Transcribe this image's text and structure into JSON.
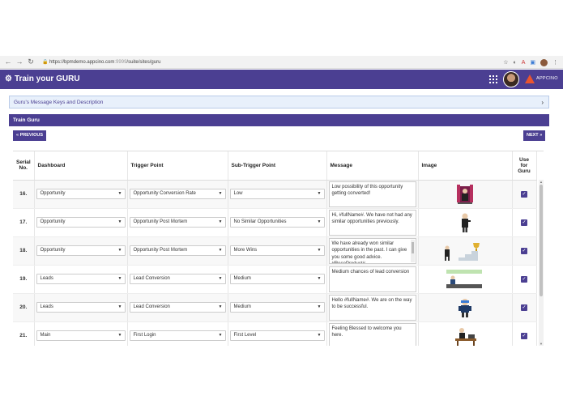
{
  "browser": {
    "url_host": "https://bpmdemo.appcino.com",
    "url_port": ":9999",
    "url_path": "/suite/sites/guru"
  },
  "app": {
    "title": "Train your GURU",
    "logo_text": "APPCINO",
    "accent": "#4b3f92",
    "logo_color": "#e9552f"
  },
  "accordion": {
    "label": "Guru's Message Keys and Description",
    "chevron": "›"
  },
  "panel": {
    "title": "Train Guru",
    "prev_label": "« PREVIOUS",
    "next_label": "NEXT »"
  },
  "table": {
    "headers": {
      "serial": "Serial No.",
      "dashboard": "Dashboard",
      "trigger": "Trigger Point",
      "subtrigger": "Sub-Trigger Point",
      "message": "Message",
      "image": "Image",
      "use": "Use for Guru"
    },
    "rows": [
      {
        "serial": "16.",
        "dashboard": "Opportunity",
        "trigger": "Opportunity Conversion Rate",
        "subtrigger": "Low",
        "message": "Low possibility of this opportunity getting converted!",
        "image_icon": "throne-character-icon",
        "checked": true
      },
      {
        "serial": "17.",
        "dashboard": "Opportunity",
        "trigger": "Opportunity Post Mortem",
        "subtrigger": "No Similar Opportunities",
        "message": "Hi, #fullName#. We have not had any similar opportunities previously.",
        "image_icon": "standing-character-icon",
        "checked": true
      },
      {
        "serial": "18.",
        "dashboard": "Opportunity",
        "trigger": "Opportunity Post Mortem",
        "subtrigger": "More Wins",
        "message": "We have already won similar opportunities in the past. I can give you some good advice. #RecoProduct#",
        "image_icon": "stairs-trophy-icon",
        "checked": true
      },
      {
        "serial": "19.",
        "dashboard": "Leads",
        "trigger": "Lead Conversion",
        "subtrigger": "Medium",
        "message": "Medium chances of lead conversion",
        "image_icon": "ramp-character-icon",
        "checked": true
      },
      {
        "serial": "20.",
        "dashboard": "Leads",
        "trigger": "Lead Conversion",
        "subtrigger": "Medium",
        "message": "Hello #fullName#. We are on the way to be successful.",
        "image_icon": "goggles-character-icon",
        "checked": true
      },
      {
        "serial": "21.",
        "dashboard": "Main",
        "trigger": "First Login",
        "subtrigger": "First Level",
        "message": "Feeling Blessed to welcome you here.",
        "image_icon": "desk-character-icon",
        "checked": true
      }
    ]
  }
}
